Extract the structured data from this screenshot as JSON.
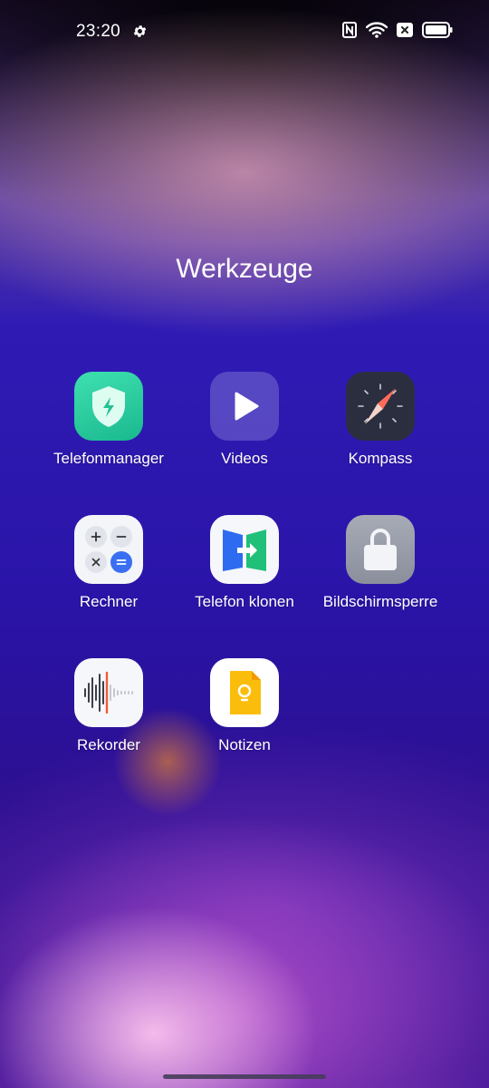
{
  "status_bar": {
    "time": "23:20",
    "icons": [
      "settings-gear-icon",
      "nfc-icon",
      "wifi-icon",
      "no-sim-icon",
      "battery-icon"
    ]
  },
  "folder": {
    "title": "Werkzeuge"
  },
  "apps": [
    {
      "label": "Telefonmanager",
      "icon": "phone-manager-shield-icon"
    },
    {
      "label": "Videos",
      "icon": "videos-play-icon"
    },
    {
      "label": "Kompass",
      "icon": "compass-icon"
    },
    {
      "label": "Rechner",
      "icon": "calculator-icon"
    },
    {
      "label": "Telefon klonen",
      "icon": "phone-clone-icon"
    },
    {
      "label": "Bildschirmsperre",
      "icon": "screen-lock-icon"
    },
    {
      "label": "Rekorder",
      "icon": "recorder-waveform-icon"
    },
    {
      "label": "Notizen",
      "icon": "notes-icon"
    }
  ]
}
